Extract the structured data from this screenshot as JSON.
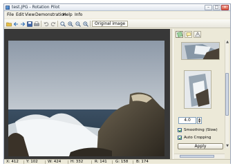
{
  "window": {
    "title": "test.JPG - Rotation Pilot",
    "controls": [
      "minimize",
      "maximize",
      "close"
    ]
  },
  "menu": {
    "items": [
      "File",
      "Edit",
      "View",
      "Demonstration",
      "Help",
      "Info"
    ]
  },
  "toolbar": {
    "buttons": [
      "open-folder-icon",
      "back-arrow-icon",
      "forward-arrow-icon",
      "save-icon",
      "print-icon",
      "undo-icon",
      "redo-icon",
      "zoom-fit-icon",
      "zoom-in-icon",
      "zoom-out-icon",
      "zoom-actual-icon"
    ],
    "original_image_label": "Original image"
  },
  "side_panel": {
    "tabs": [
      "rotate-tool-icon",
      "speech-bubble-icon",
      "warning-triangle-icon"
    ],
    "angle_value": "4.0",
    "smoothing_label": "Smoothing (Slow)",
    "smoothing_checked": true,
    "auto_cropping_label": "Auto Cropping",
    "auto_cropping_checked": true,
    "apply_label": "Apply"
  },
  "status": {
    "x": "X: 412",
    "y": "Y: 102",
    "w": "W: 424",
    "h": "H: 332",
    "r": "R: 141",
    "g": "G: 158",
    "b": "B: 174"
  },
  "colors": {
    "canvas_background": "#383838",
    "sky": "#a9b3bf",
    "sea": "#2c3f52"
  }
}
